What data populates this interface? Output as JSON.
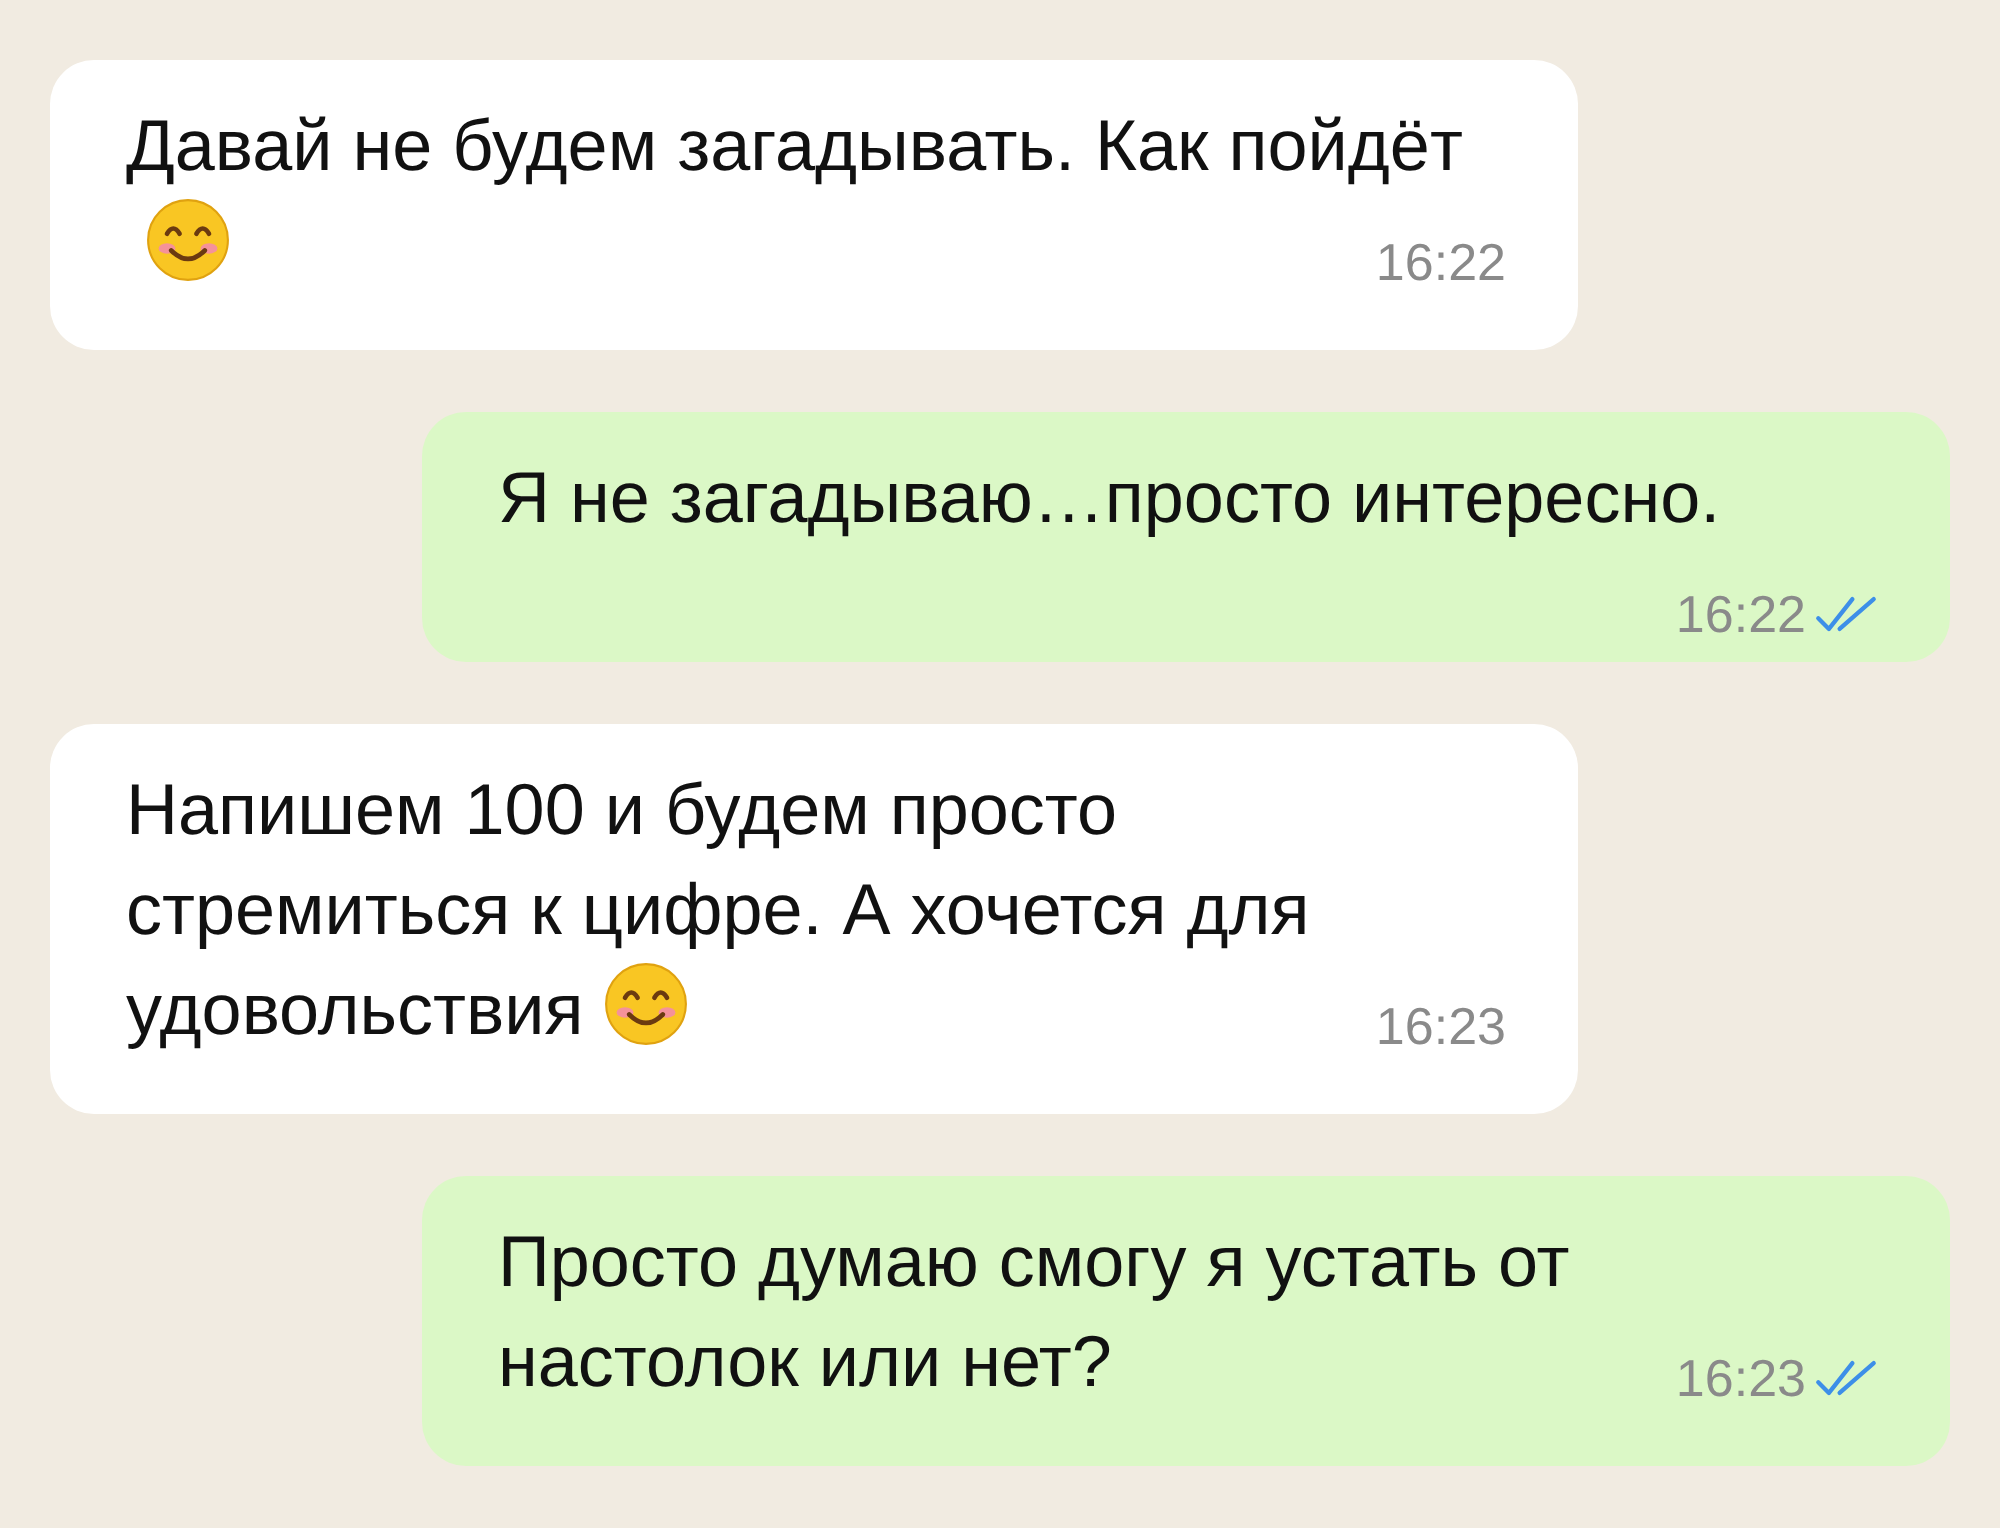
{
  "messages": [
    {
      "kind": "incoming",
      "text": "Давай не будем загадывать. Как пойдёт",
      "emoji": true,
      "time": "16:22"
    },
    {
      "kind": "outgoing",
      "text": "Я не загадываю…просто интересно.",
      "emoji": false,
      "time": "16:22",
      "read": true
    },
    {
      "kind": "incoming",
      "text": "Напишем 100 и будем просто стремиться к цифре. А хочется для удовольствия",
      "emoji": true,
      "time": "16:23"
    },
    {
      "kind": "outgoing",
      "text": "Просто думаю смогу я устать от настолок или нет?",
      "emoji": false,
      "time": "16:23",
      "read": true
    }
  ]
}
